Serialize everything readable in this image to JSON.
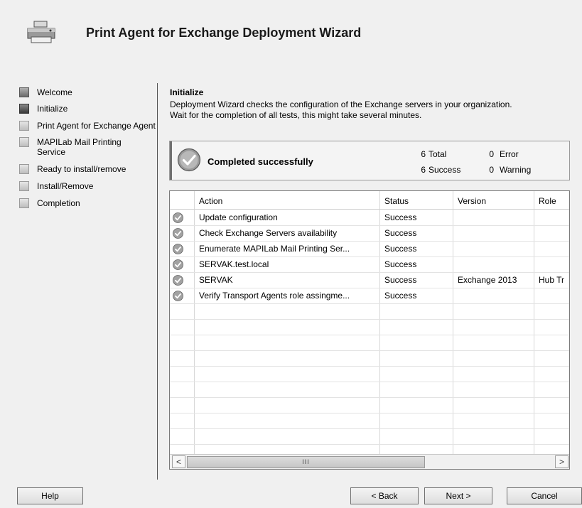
{
  "window": {
    "title": "Print Agent for Exchange Deployment Wizard"
  },
  "steps": [
    {
      "label": "Welcome",
      "state": "done"
    },
    {
      "label": "Initialize",
      "state": "current"
    },
    {
      "label": "Print Agent for Exchange Agent",
      "state": "future"
    },
    {
      "label": "MAPILab Mail Printing Service",
      "state": "future"
    },
    {
      "label": "Ready to install/remove",
      "state": "future"
    },
    {
      "label": "Install/Remove",
      "state": "future"
    },
    {
      "label": "Completion",
      "state": "future"
    }
  ],
  "section": {
    "title": "Initialize",
    "line1": "Deployment Wizard checks the configuration of the Exchange servers in your organization.",
    "line2": "Wait for the completion of all tests, this might take several minutes."
  },
  "summary": {
    "status": "Completed successfully",
    "total_count": "6",
    "total_label": "Total",
    "success_count": "6",
    "success_label": "Success",
    "error_count": "0",
    "error_label": "Error",
    "warning_count": "0",
    "warning_label": "Warning"
  },
  "table": {
    "columns": [
      "",
      "Action",
      "Status",
      "Version",
      "Role"
    ],
    "rows": [
      {
        "action": "Update configuration",
        "status": "Success",
        "version": "",
        "role": ""
      },
      {
        "action": "Check Exchange Servers availability",
        "status": "Success",
        "version": "",
        "role": ""
      },
      {
        "action": "Enumerate MAPILab Mail Printing Ser...",
        "status": "Success",
        "version": "",
        "role": ""
      },
      {
        "action": "SERVAK.test.local",
        "status": "Success",
        "version": "",
        "role": ""
      },
      {
        "action": "SERVAK",
        "status": "Success",
        "version": "Exchange 2013",
        "role": "Hub Tr"
      },
      {
        "action": "Verify Transport Agents role assingme...",
        "status": "Success",
        "version": "",
        "role": ""
      }
    ],
    "empty_rows": 10
  },
  "scrollbar": {
    "left": "<",
    "right": ">",
    "thumb": "III"
  },
  "buttons": {
    "help": "Help",
    "back": "< Back",
    "next": "Next >",
    "cancel": "Cancel"
  }
}
